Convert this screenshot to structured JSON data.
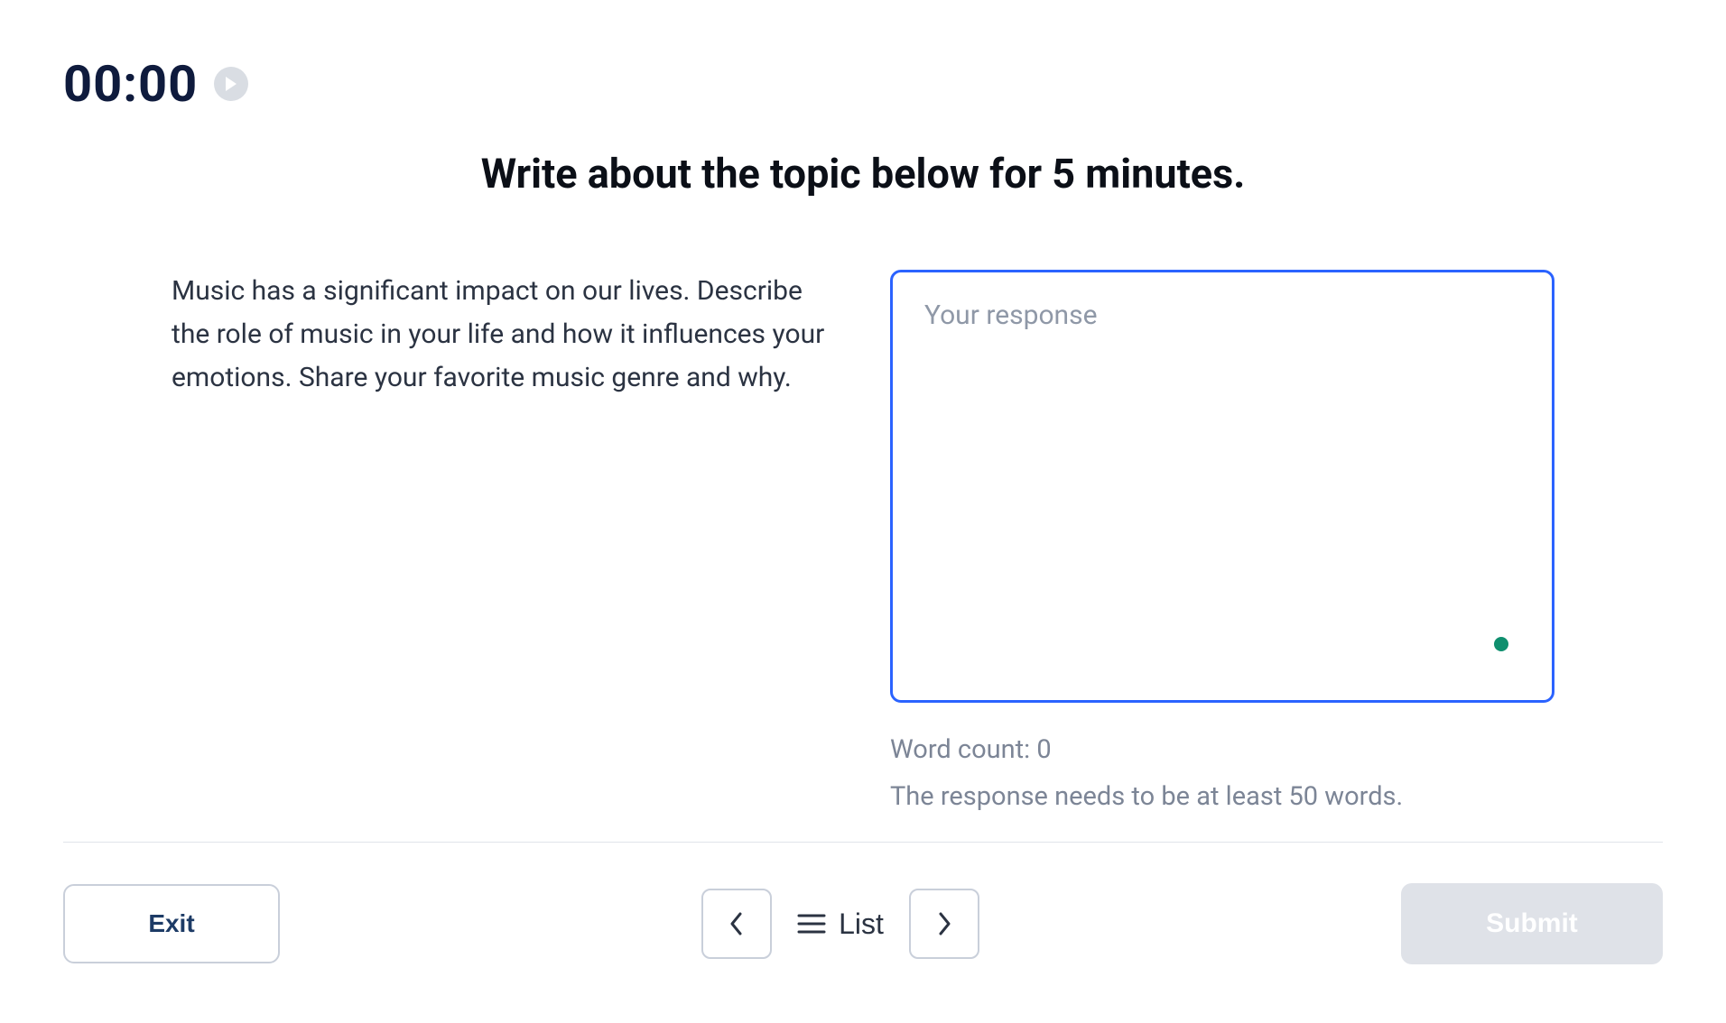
{
  "timer": {
    "value": "00:00"
  },
  "heading": "Write about the topic below for 5 minutes.",
  "prompt_text": "Music has a significant impact on our lives. Describe the role of music in your life and how it influences your emotions. Share your favorite music genre and why.",
  "response": {
    "placeholder": "Your response",
    "value": ""
  },
  "word_count_label": "Word count: 0",
  "hint": "The response needs to be at least 50 words.",
  "footer": {
    "exit": "Exit",
    "list": "List",
    "submit": "Submit"
  }
}
